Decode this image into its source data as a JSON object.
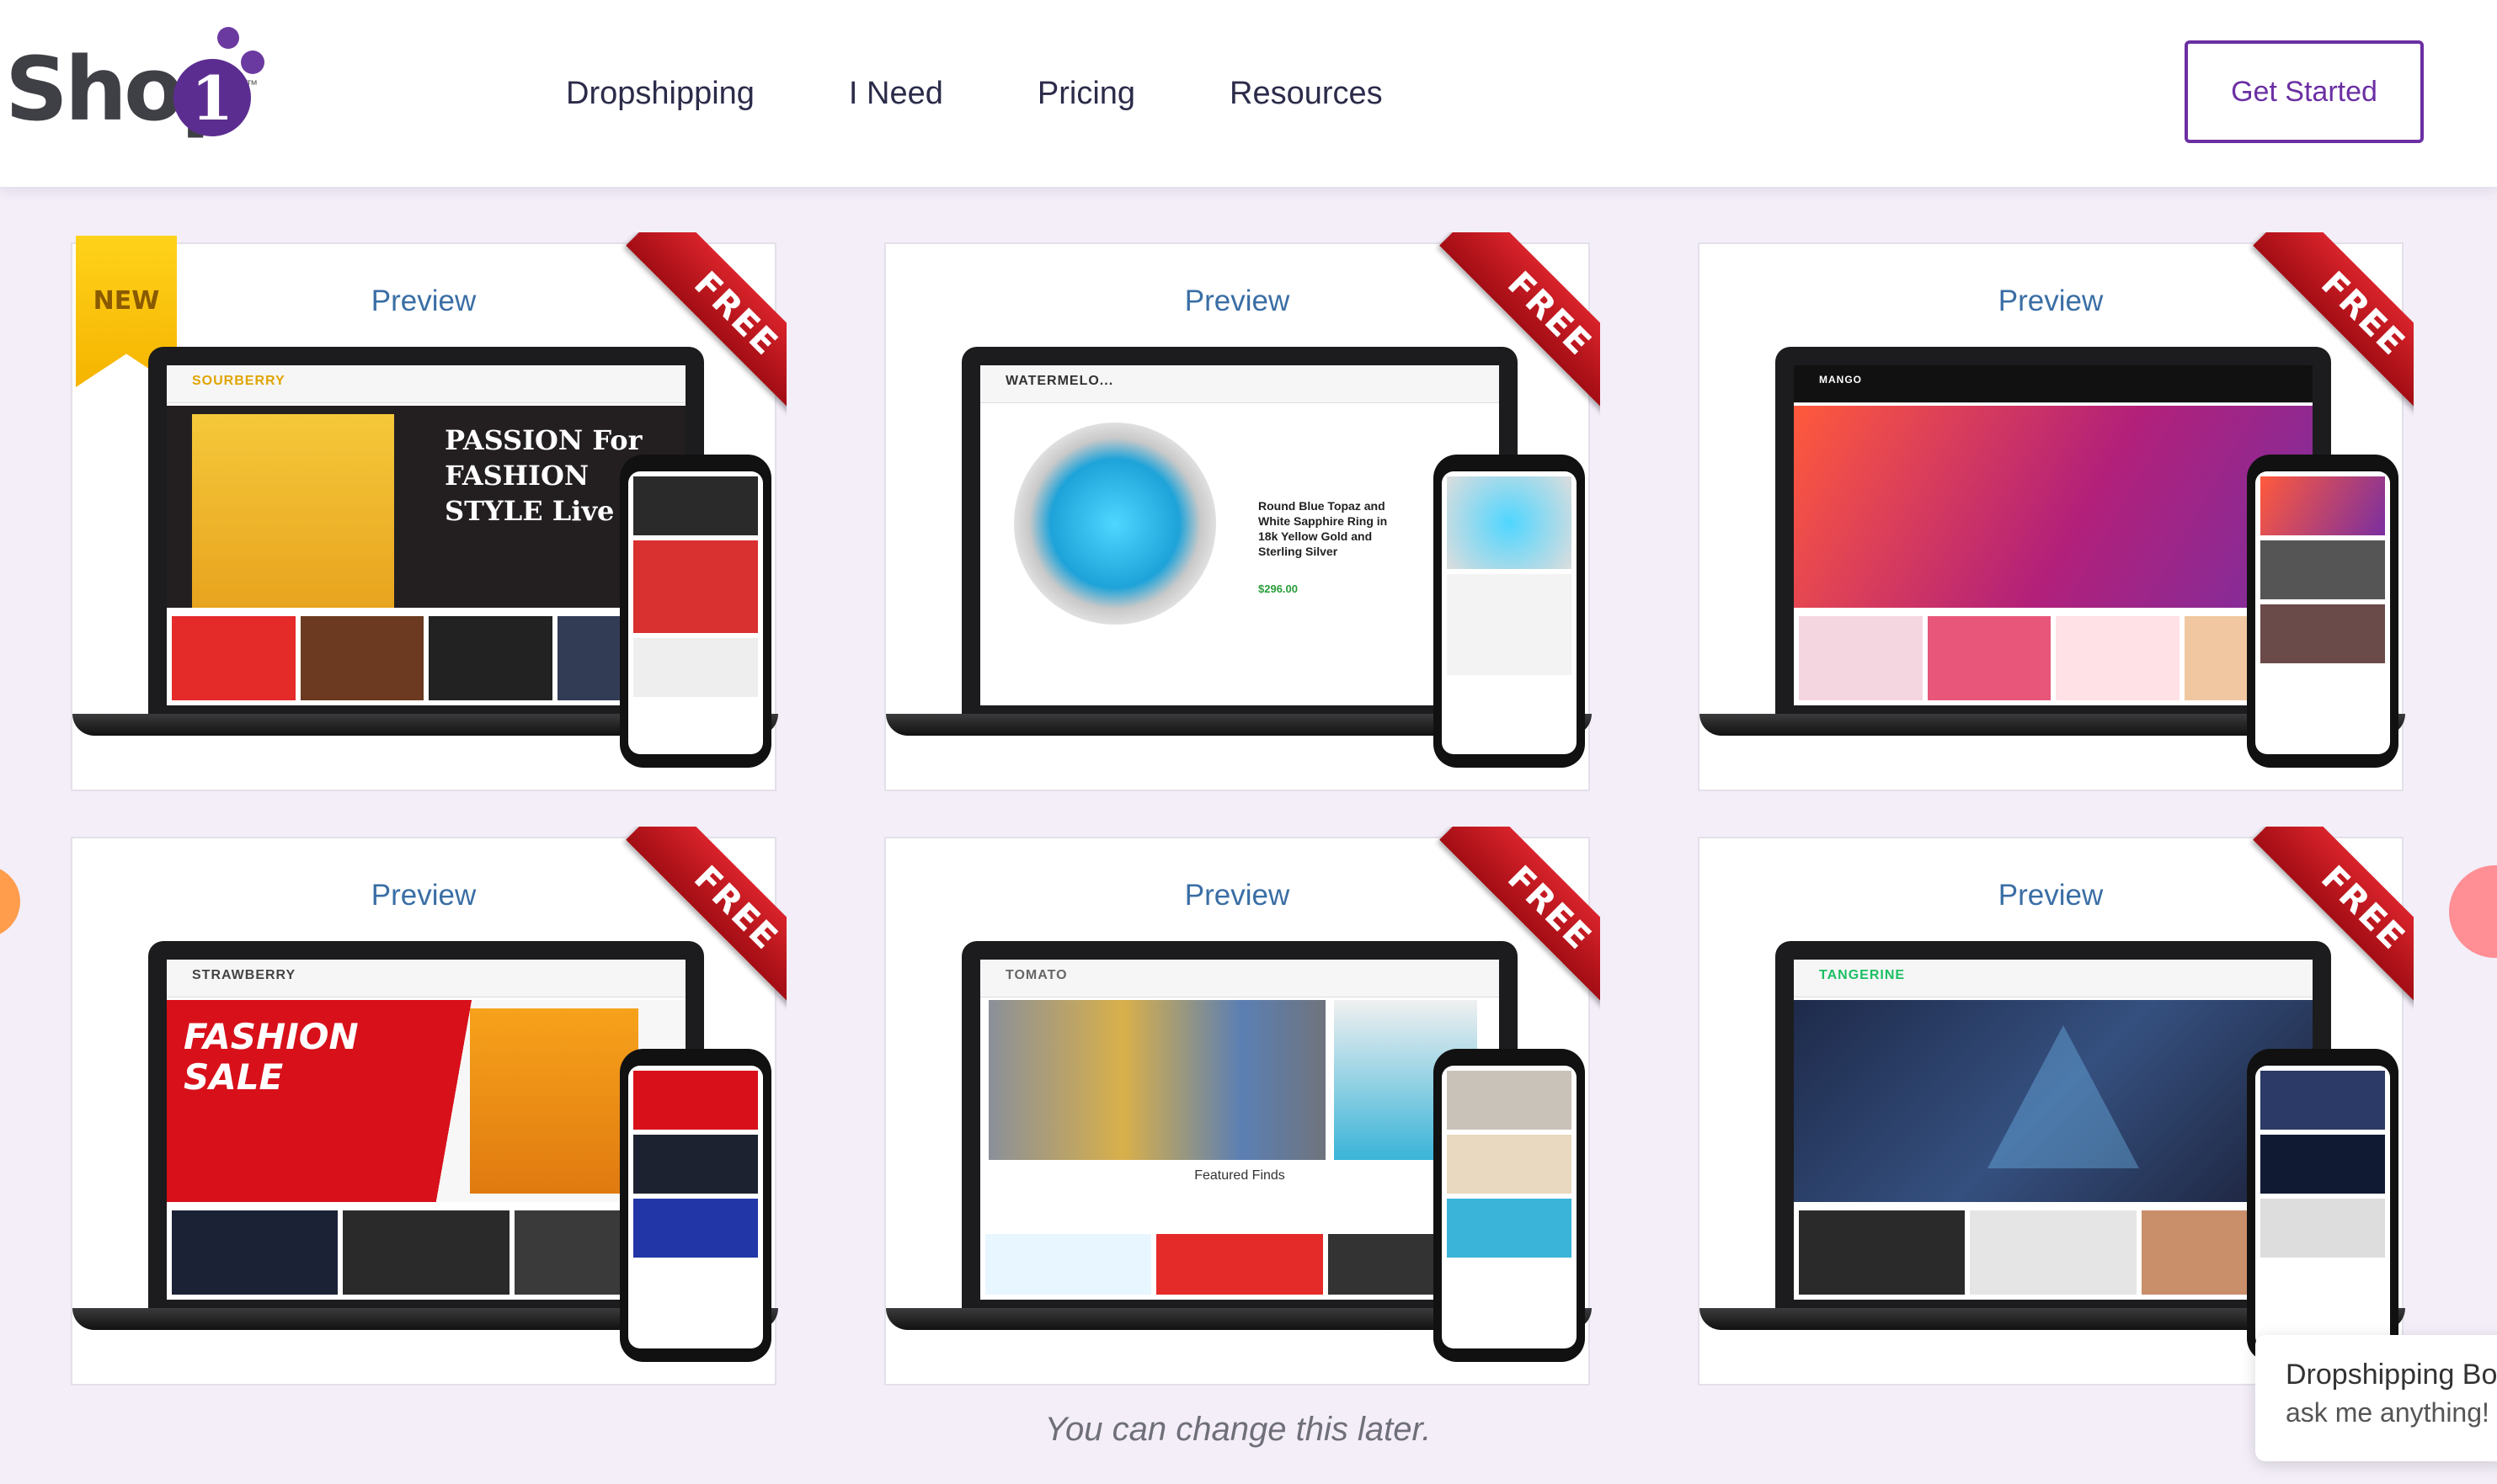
{
  "header": {
    "logo_text": "Shop",
    "logo_number": "1",
    "logo_tm": "™",
    "nav": [
      "Dropshipping",
      "I Need",
      "Pricing",
      "Resources"
    ],
    "cta_label": "Get Started"
  },
  "themes": [
    {
      "preview": "Preview",
      "ribbon": "FREE",
      "badge": "NEW",
      "store_name": "SOURBERRY",
      "hero_text": "PASSION For FASHION STYLE Live"
    },
    {
      "preview": "Preview",
      "ribbon": "FREE",
      "store_name": "WATERMELO...",
      "hero_text": "Round Blue Topaz and White Sapphire Ring in 18k Yellow Gold and Sterling Silver",
      "price": "$296.00"
    },
    {
      "preview": "Preview",
      "ribbon": "FREE",
      "store_name": "MANGO"
    },
    {
      "preview": "Preview",
      "ribbon": "FREE",
      "store_name": "STRAWBERRY",
      "hero_text": "FASHION SALE"
    },
    {
      "preview": "Preview",
      "ribbon": "FREE",
      "store_name": "TOMATO",
      "hero_text": "Featured Finds"
    },
    {
      "preview": "Preview",
      "ribbon": "FREE",
      "store_name": "TANGERINE"
    }
  ],
  "footnote": "You can change this later.",
  "chat": {
    "title": "Dropshipping Bo",
    "subtitle": "ask me anything!"
  },
  "colors": {
    "brand": "#5c2d91",
    "preview_link": "#3a6ea5",
    "ribbon": "#c8161e",
    "page_bg": "#f3eef8"
  }
}
